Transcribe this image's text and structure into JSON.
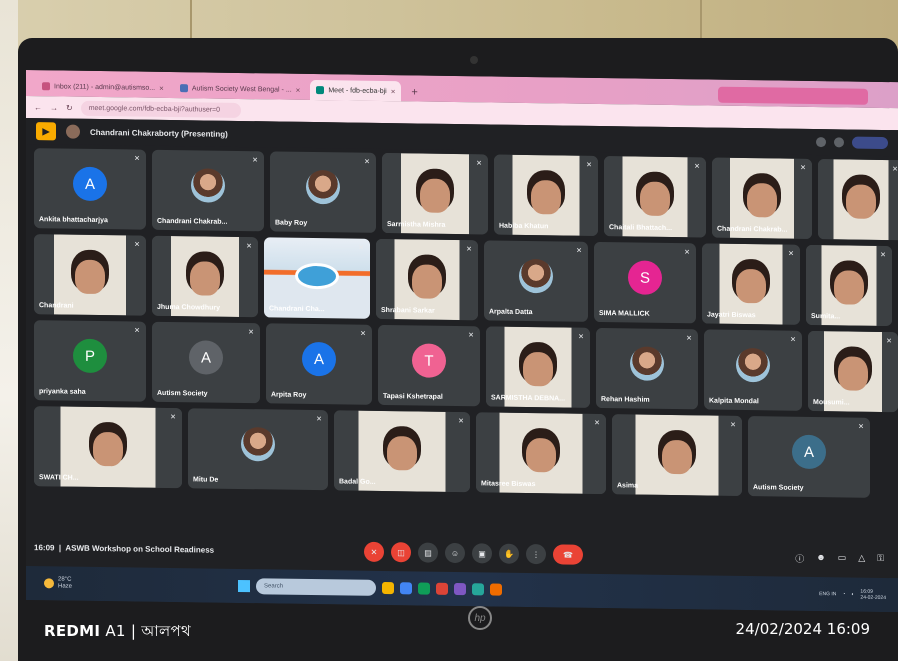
{
  "browser": {
    "tabs": [
      {
        "label": "Inbox (211) - admin@autismso...",
        "active": false
      },
      {
        "label": "Autism Society West Bengal - ...",
        "active": false
      },
      {
        "label": "Meet - fdb-ecba-bji",
        "active": true
      }
    ],
    "url": "meet.google.com/fdb-ecba-bji?authuser=0"
  },
  "meet": {
    "presenting_label": "Chandrani Chakraborty (Presenting)",
    "meeting_time": "16:09",
    "meeting_title": "ASWB Workshop on School Readiness",
    "separator": "|",
    "tiles": [
      [
        {
          "name": "Ankita bhattacharjya",
          "type": "initial",
          "initial": "A",
          "color": "#1a73e8"
        },
        {
          "name": "Chandrani Chakrab...",
          "type": "photo"
        },
        {
          "name": "Baby Roy",
          "type": "photo"
        },
        {
          "name": "Sarmistha Mishra",
          "type": "video"
        },
        {
          "name": "Habiba Khatun",
          "type": "video"
        },
        {
          "name": "Chaitali Bhattach...",
          "type": "video"
        },
        {
          "name": "Chandrani Chakrab...",
          "type": "video"
        },
        {
          "name": "",
          "type": "video"
        }
      ],
      [
        {
          "name": "Chandrani",
          "type": "video"
        },
        {
          "name": "Jhuma Chowdhury",
          "type": "video"
        },
        {
          "name": "Chandrani Cha...",
          "type": "presentation"
        },
        {
          "name": "Shrabani Sarkar",
          "type": "video"
        },
        {
          "name": "Arpalta Datta",
          "type": "photo"
        },
        {
          "name": "SIMA MALLICK",
          "type": "initial",
          "initial": "S",
          "color": "#e52592"
        },
        {
          "name": "Jayatri Biswas",
          "type": "video"
        },
        {
          "name": "Sumita...",
          "type": "video"
        }
      ],
      [
        {
          "name": "priyanka saha",
          "type": "initial",
          "initial": "P",
          "color": "#1e8e3e"
        },
        {
          "name": "Autism Society",
          "type": "initial",
          "initial": "A",
          "color": "#5f6368"
        },
        {
          "name": "Arpita Roy",
          "type": "initial",
          "initial": "A",
          "color": "#1a73e8"
        },
        {
          "name": "Tapasi Kshetrapal",
          "type": "initial",
          "initial": "T",
          "color": "#f06292"
        },
        {
          "name": "SARMISTHA DEBNA...",
          "type": "video"
        },
        {
          "name": "Rehan Hashim",
          "type": "photo"
        },
        {
          "name": "Kalpita Mondal",
          "type": "photo"
        },
        {
          "name": "Mousumi...",
          "type": "video"
        }
      ],
      [
        {
          "name": "SWATI CH...",
          "type": "video"
        },
        {
          "name": "Mitu De",
          "type": "photo"
        },
        {
          "name": "Badal Go...",
          "type": "video"
        },
        {
          "name": "Mitasree Biswas",
          "type": "video"
        },
        {
          "name": "Asima",
          "type": "video"
        },
        {
          "name": "Autism Society",
          "type": "initial",
          "initial": "A",
          "color": "#3c6e8a"
        }
      ]
    ],
    "controls": [
      "mic-off",
      "camera-off",
      "captions",
      "emoji",
      "present",
      "raise-hand",
      "more",
      "end-call"
    ]
  },
  "taskbar": {
    "weather_temp": "28°C",
    "weather_desc": "Haze",
    "search_placeholder": "Search",
    "lang": "ENG\nIN",
    "time": "16:09",
    "date": "24-02-2024"
  },
  "watermark": {
    "device": "REDMI",
    "model": "A1 | আলপথ",
    "datetime": "24/02/2024  16:09"
  }
}
